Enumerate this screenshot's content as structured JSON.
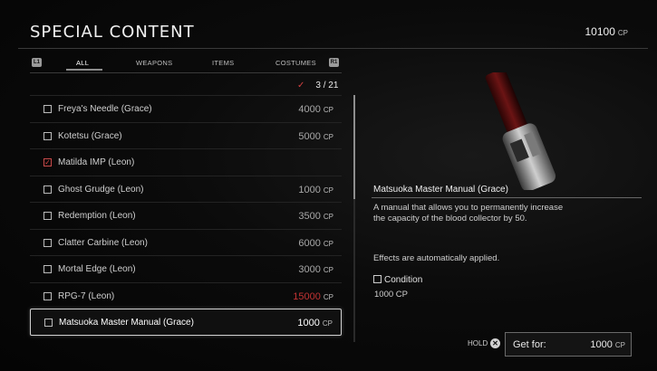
{
  "header": {
    "title": "SPECIAL CONTENT",
    "points_value": "10100",
    "points_unit": "CP"
  },
  "tabs": {
    "left_button": "L1",
    "right_button": "R1",
    "items": [
      {
        "label": "ALL",
        "active": true
      },
      {
        "label": "WEAPONS",
        "active": false
      },
      {
        "label": "ITEMS",
        "active": false
      },
      {
        "label": "COSTUMES",
        "active": false
      }
    ]
  },
  "counter": {
    "check": "✓",
    "text": "3 / 21"
  },
  "list": {
    "items": [
      {
        "name": "Freya's Needle (Grace)",
        "price": "4000",
        "unit": "CP",
        "checked": false
      },
      {
        "name": "Kotetsu (Grace)",
        "price": "5000",
        "unit": "CP",
        "checked": false
      },
      {
        "name": "Matilda IMP (Leon)",
        "price": "",
        "unit": "",
        "checked": true
      },
      {
        "name": "Ghost Grudge (Leon)",
        "price": "1000",
        "unit": "CP",
        "checked": false
      },
      {
        "name": "Redemption (Leon)",
        "price": "3500",
        "unit": "CP",
        "checked": false
      },
      {
        "name": "Clatter Carbine (Leon)",
        "price": "6000",
        "unit": "CP",
        "checked": false
      },
      {
        "name": "Mortal Edge (Leon)",
        "price": "3000",
        "unit": "CP",
        "checked": false
      },
      {
        "name": "RPG-7 (Leon)",
        "price": "15000",
        "unit": "CP",
        "checked": false,
        "unaffordable": true
      },
      {
        "name": "Matsuoka Master Manual (Grace)",
        "price": "1000",
        "unit": "CP",
        "checked": false,
        "selected": true
      }
    ]
  },
  "detail": {
    "title": "Matsuoka Master Manual (Grace)",
    "description": "A manual that allows you to permanently increase the capacity of the blood collector by 50.",
    "effects": "Effects are automatically applied.",
    "condition_label": "Condition",
    "condition_value": "1000 CP"
  },
  "footer": {
    "hold_label": "HOLD",
    "hold_button": "✕",
    "get_for_label": "Get for:",
    "get_for_value": "1000",
    "get_for_unit": "CP"
  },
  "colors": {
    "accent_red": "#c23333",
    "selection_border": "#cfcfcf"
  }
}
